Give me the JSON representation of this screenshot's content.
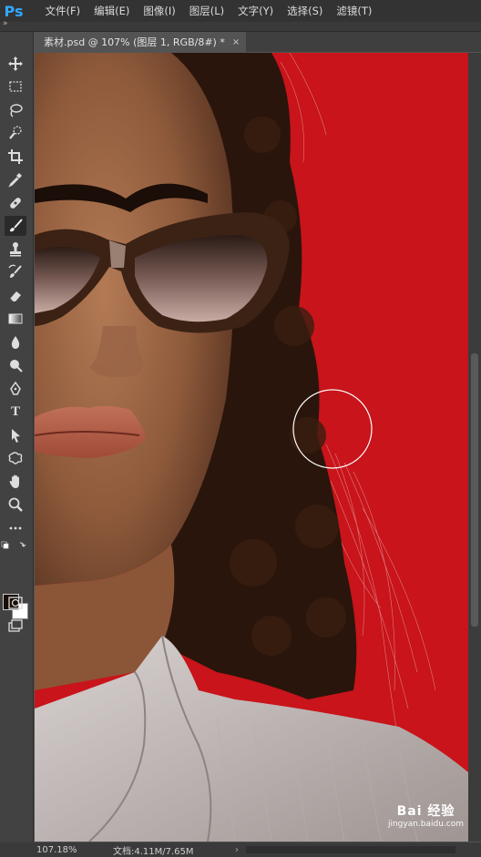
{
  "app": {
    "logo": "Ps",
    "accent": "#31a8ff"
  },
  "menu": [
    "文件(F)",
    "编辑(E)",
    "图像(I)",
    "图层(L)",
    "文字(Y)",
    "选择(S)",
    "滤镜(T)"
  ],
  "document_tab": {
    "title": "素材.psd @ 107% (图层 1, RGB/8#) *",
    "close": "×"
  },
  "toolbar": {
    "tools": [
      "move-icon",
      "marquee-icon",
      "lasso-icon",
      "quick-select-icon",
      "crop-icon",
      "eyedropper-icon",
      "healing-icon",
      "brush-icon",
      "clone-stamp-icon",
      "history-brush-icon",
      "eraser-icon",
      "gradient-icon",
      "blur-icon",
      "dodge-icon",
      "pen-icon",
      "type-icon",
      "path-select-icon",
      "custom-shape-icon",
      "hand-icon",
      "zoom-icon",
      "more-icon"
    ],
    "active_tool": "brush-icon",
    "type_tool_label": "T",
    "foreground_color": "#1a0e08",
    "background_color": "#ffffff"
  },
  "canvas": {
    "background_color": "#c8141a"
  },
  "status": {
    "zoom": "107.18%",
    "doc_info": "文档:4.11M/7.65M",
    "arrow": "›"
  },
  "watermark": {
    "brand": "Bai",
    "brand_cn": "经验",
    "url": "jingyan.baidu.com"
  }
}
